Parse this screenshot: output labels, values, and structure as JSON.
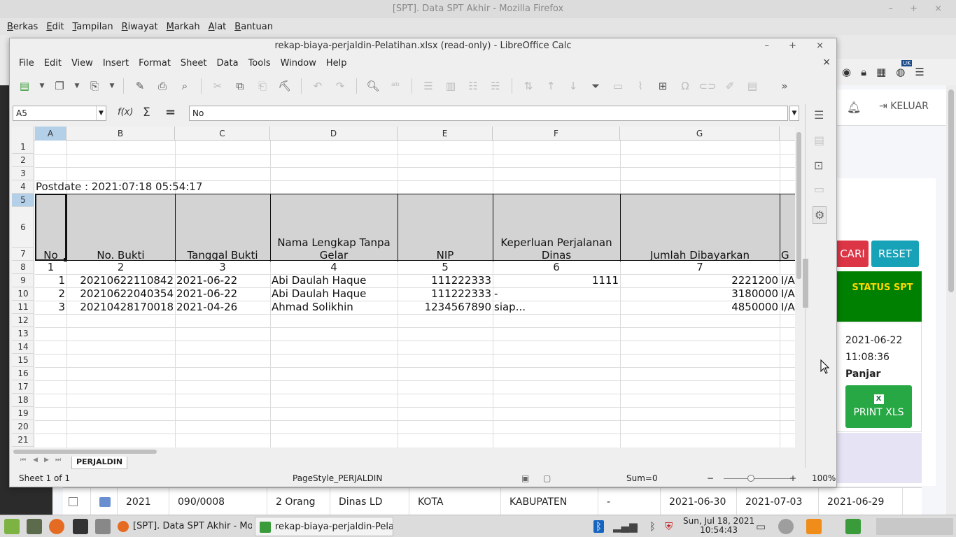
{
  "firefox": {
    "title": "[SPT]. Data SPT Akhir - Mozilla Firefox",
    "window_controls": "– + ×",
    "menu": [
      "Berkas",
      "Edit",
      "Tampilan",
      "Riwayat",
      "Markah",
      "Alat",
      "Bantuan"
    ],
    "toolbar_icons": [
      "account-icon",
      "lock-icon",
      "qr-icon",
      "globe-uk-icon",
      "menu-icon"
    ],
    "uk_badge": "UK"
  },
  "webpage": {
    "keluar": "KELUAR",
    "cari": "CARI",
    "reset": "RESET",
    "status_header": "STATUS SPT",
    "status_date": "2021-06-22",
    "status_time": "11:08:36",
    "status_label": "Panjar",
    "print_label": "PRINT XLS",
    "print_icon_letter": "X",
    "bottom_row": [
      "2021",
      "090/0008",
      "2 Orang",
      "Dinas LD",
      "KOTA",
      "KABUPATEN",
      "-",
      "2021-06-30",
      "2021-07-03",
      "2021-06-29"
    ]
  },
  "calc": {
    "title": "rekap-biaya-perjaldin-Pelatihan.xlsx (read-only) - LibreOffice Calc",
    "window_controls": "– + ×",
    "menu": [
      "File",
      "Edit",
      "View",
      "Insert",
      "Format",
      "Sheet",
      "Data",
      "Tools",
      "Window",
      "Help"
    ],
    "doc_close": "×",
    "name_box": "A5",
    "fx": "f(x)",
    "sigma": "Σ",
    "equals": "=",
    "formula": "No",
    "columns": [
      "A",
      "B",
      "C",
      "D",
      "E",
      "F",
      "G"
    ],
    "rows": [
      "1",
      "2",
      "3",
      "4",
      "5",
      "6",
      "7",
      "8",
      "9",
      "10",
      "11",
      "12",
      "13",
      "14",
      "15",
      "16",
      "17",
      "18",
      "19",
      "20",
      "21"
    ],
    "postdate": "Postdate : 2021:07:18 05:54:17",
    "headers": {
      "a": "No",
      "b": "No. Bukti",
      "c": "Tanggal Bukti",
      "d1": "Nama Lengkap Tanpa",
      "d2": "Gelar",
      "e": "NIP",
      "f1": "Keperluan Perjalanan",
      "f2": "Dinas",
      "g": "Jumlah Dibayarkan",
      "h": "G"
    },
    "numbering": [
      "1",
      "2",
      "3",
      "4",
      "5",
      "6",
      "7"
    ],
    "data_rows": [
      {
        "no": "1",
        "bukti": "20210622110842",
        "tanggal": "2021-06-22",
        "nama": "Abi Daulah Haque",
        "nip": "111222333",
        "keperluan": "1111",
        "jumlah": "2221200",
        "g": "I/A"
      },
      {
        "no": "2",
        "bukti": "20210622040354",
        "tanggal": "2021-06-22",
        "nama": "Abi Daulah Haque",
        "nip": "111222333",
        "keperluan": "-",
        "jumlah": "3180000",
        "g": "I/A"
      },
      {
        "no": "3",
        "bukti": "20210428170018",
        "tanggal": "2021-04-26",
        "nama": "Ahmad Solikhin",
        "nip": "1234567890",
        "keperluan": "siap...",
        "jumlah": "4850000",
        "g": "I/A"
      }
    ],
    "sheet_tab": "PERJALDIN",
    "status": {
      "sheet": "Sheet 1 of 1",
      "page_style": "PageStyle_PERJALDIN",
      "sum": "Sum=0",
      "zoom": "100%",
      "zoom_minus": "−",
      "zoom_plus": "+"
    }
  },
  "taskbar": {
    "tasks": [
      "[SPT]. Data SPT Akhir - Mozil...",
      "rekap-biaya-perjaldin-Pelati..."
    ],
    "clock_date": "Sun, Jul 18, 2021",
    "clock_time": "10:54:43"
  }
}
